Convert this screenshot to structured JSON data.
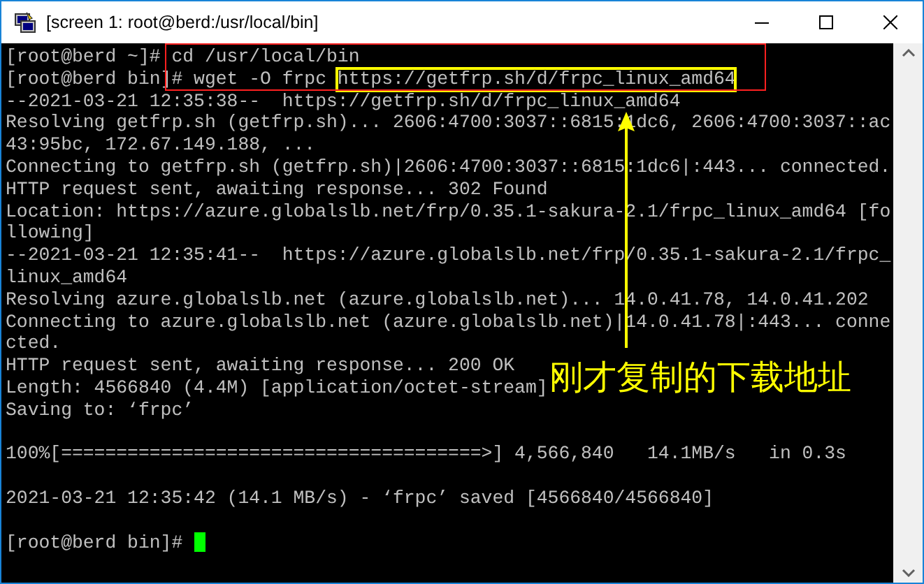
{
  "window": {
    "title": "[screen 1: root@berd:/usr/local/bin]"
  },
  "terminal": {
    "lines": [
      {
        "kind": "text",
        "text": "[root@berd ~]# cd /usr/local/bin"
      },
      {
        "kind": "text",
        "text": "[root@berd bin]# wget -O frpc ",
        "highlight": "https://getfrp.sh/d/frpc_linux_amd64"
      },
      {
        "kind": "text",
        "text": "--2021-03-21 12:35:38--  https://getfrp.sh/d/frpc_linux_amd64"
      },
      {
        "kind": "text",
        "text": "Resolving getfrp.sh (getfrp.sh)... 2606:4700:3037::6815:1dc6, 2606:4700:3037::ac"
      },
      {
        "kind": "text",
        "text": "43:95bc, 172.67.149.188, ..."
      },
      {
        "kind": "text",
        "text": "Connecting to getfrp.sh (getfrp.sh)|2606:4700:3037::6815:1dc6|:443... connected."
      },
      {
        "kind": "text",
        "text": "HTTP request sent, awaiting response... 302 Found"
      },
      {
        "kind": "text",
        "text": "Location: https://azure.globalslb.net/frp/0.35.1-sakura-2.1/frpc_linux_amd64 [fo"
      },
      {
        "kind": "text",
        "text": "llowing]"
      },
      {
        "kind": "text",
        "text": "--2021-03-21 12:35:41--  https://azure.globalslb.net/frp/0.35.1-sakura-2.1/frpc_"
      },
      {
        "kind": "text",
        "text": "linux_amd64"
      },
      {
        "kind": "text",
        "text": "Resolving azure.globalslb.net (azure.globalslb.net)... 14.0.41.78, 14.0.41.202"
      },
      {
        "kind": "text",
        "text": "Connecting to azure.globalslb.net (azure.globalslb.net)|14.0.41.78|:443... conne"
      },
      {
        "kind": "text",
        "text": "cted."
      },
      {
        "kind": "text",
        "text": "HTTP request sent, awaiting response... 200 OK"
      },
      {
        "kind": "text",
        "text": "Length: 4566840 (4.4M) [application/octet-stream]"
      },
      {
        "kind": "text",
        "text": "Saving to: ‘frpc’"
      },
      {
        "kind": "blank"
      },
      {
        "kind": "text",
        "text": "100%[======================================>] 4,566,840   14.1MB/s   in 0.3s"
      },
      {
        "kind": "blank"
      },
      {
        "kind": "text",
        "text": "2021-03-21 12:35:42 (14.1 MB/s) - ‘frpc’ saved [4566840/4566840]"
      },
      {
        "kind": "blank"
      },
      {
        "kind": "prompt",
        "text": "[root@berd bin]# "
      }
    ]
  },
  "annotation": {
    "caption": "刚才复制的下载地址"
  }
}
